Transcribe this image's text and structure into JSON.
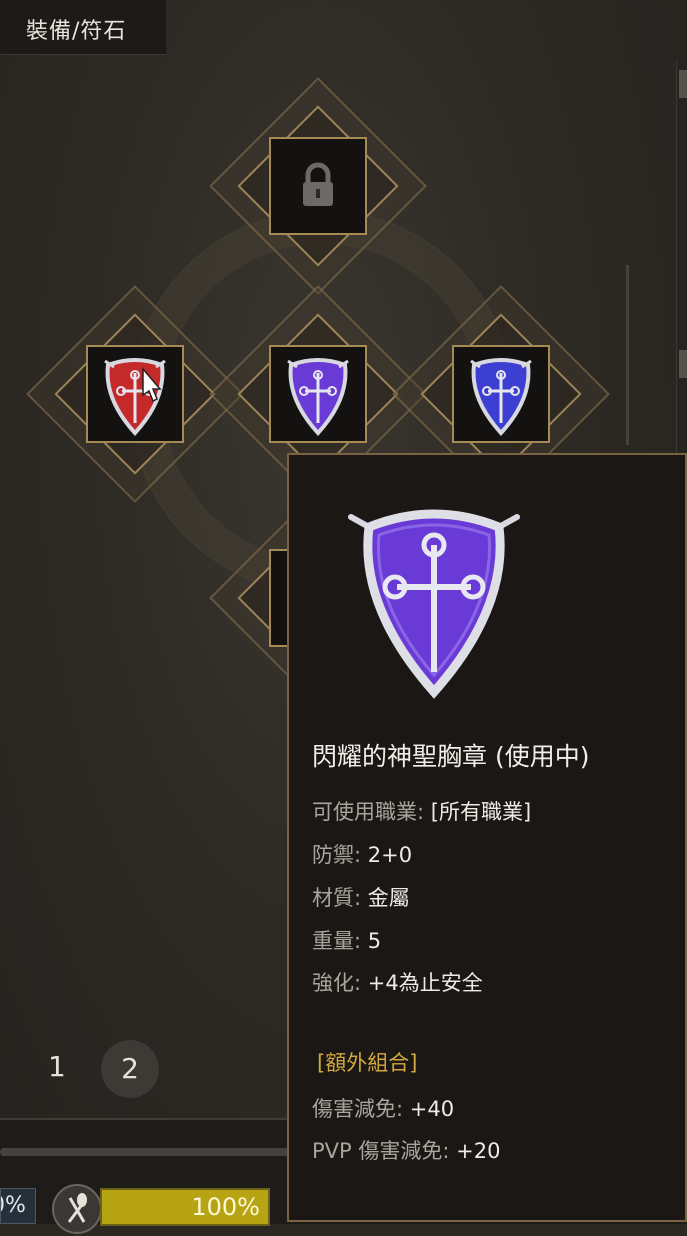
{
  "header": {
    "title": "裝備/符石"
  },
  "slots": [
    {
      "name": "locked-slot",
      "state": "locked",
      "icon": "lock-icon"
    },
    {
      "name": "red-shield-slot",
      "state": "equipped",
      "icon": "red-shield-icon",
      "color": "#c42a2a"
    },
    {
      "name": "purple-shield-slot",
      "state": "equipped",
      "icon": "purple-shield-icon",
      "color": "#6a3ad6"
    },
    {
      "name": "blue-shield-slot",
      "state": "equipped",
      "icon": "blue-shield-icon",
      "color": "#3c3fd2"
    }
  ],
  "pager": {
    "pages": [
      "1",
      "2"
    ],
    "active": "2"
  },
  "status": {
    "left_pct": "0%",
    "food_pct": "100%",
    "food_level": 1.0
  },
  "tooltip": {
    "title": "閃耀的神聖胸章 (使用中)",
    "class_label": "可使用職業:",
    "class_value": "[所有職業]",
    "def_label": "防禦:",
    "def_value": "2+0",
    "material_label": "材質:",
    "material_value": "金屬",
    "weight_label": "重量:",
    "weight_value": "5",
    "enchant_label": "強化:",
    "enchant_value": "+4為止安全",
    "set_header": "[額外組合]",
    "dmg_red_label": "傷害減免:",
    "dmg_red_value": "+40",
    "pvp_label": "PVP 傷害減免:",
    "pvp_value": "+20"
  },
  "colors": {
    "accent_gold": "#d3a83f",
    "frame": "#a58a56",
    "tooltip_bg": "#1a1714"
  }
}
